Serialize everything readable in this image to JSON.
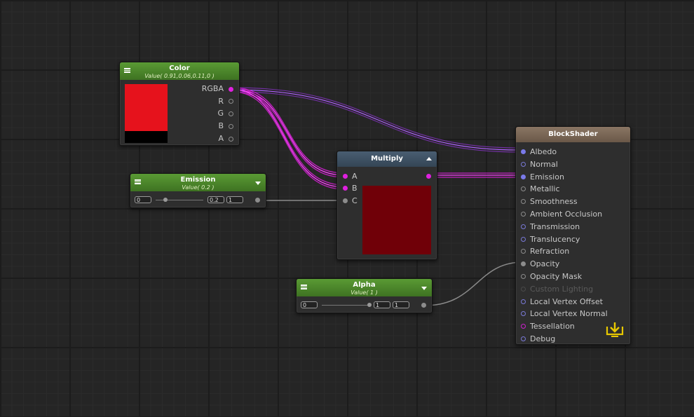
{
  "nodes": {
    "color": {
      "title": "Color",
      "subtitle": "Value( 0.91,0.06,0.11,0 )",
      "swatch_color": "#e6121c",
      "ports": [
        "RGBA",
        "R",
        "G",
        "B",
        "A"
      ]
    },
    "emission": {
      "title": "Emission",
      "subtitle": "Value( 0.2 )",
      "min": "0",
      "value": "0.2",
      "max": "1",
      "level": 0.2
    },
    "multiply": {
      "title": "Multiply",
      "ports": [
        "A",
        "B",
        "C"
      ],
      "preview_color": "#700008"
    },
    "alpha": {
      "title": "Alpha",
      "subtitle": "Value( 1 )",
      "min": "0",
      "value": "1",
      "max": "1",
      "level": 1.0
    },
    "blockshader": {
      "title": "BlockShader",
      "inputs": [
        "Albedo",
        "Normal",
        "Emission",
        "Metallic",
        "Smoothness",
        "Ambient Occlusion",
        "Transmission",
        "Translucency",
        "Refraction",
        "Opacity",
        "Opacity Mask",
        "Custom Lighting",
        "Local Vertex Offset",
        "Local Vertex Normal",
        "Tessellation",
        "Debug"
      ],
      "action_icon": "download-tray-icon"
    }
  },
  "colors": {
    "wire_color": "#c030e0",
    "wire_float": "#8a8a8a",
    "accent_yellow": "#e8c800"
  }
}
